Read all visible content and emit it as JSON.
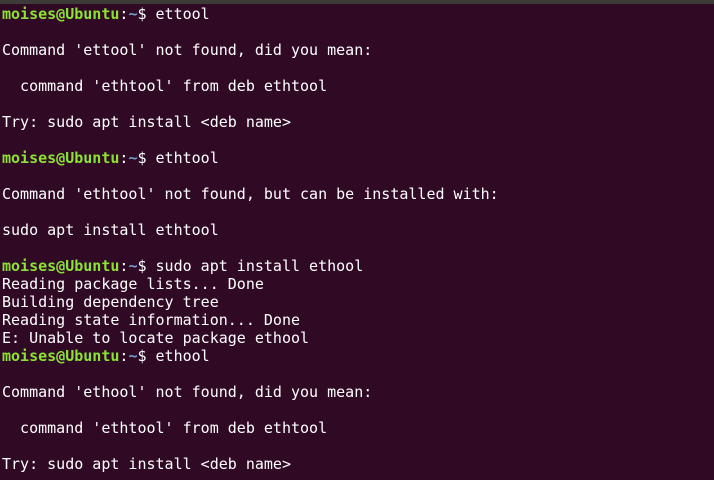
{
  "terminal": {
    "colors": {
      "background": "#300a24",
      "text": "#ffffff",
      "prompt_user": "#8ae234",
      "prompt_path": "#729fcf"
    },
    "lines": [
      {
        "type": "prompt",
        "user": "moises@Ubuntu",
        "sep": ":",
        "path": "~",
        "symbol": "$ ",
        "command": "ettool"
      },
      {
        "type": "output",
        "text": ""
      },
      {
        "type": "output",
        "text": "Command 'ettool' not found, did you mean:"
      },
      {
        "type": "output",
        "text": ""
      },
      {
        "type": "output",
        "text": "  command 'ethtool' from deb ethtool"
      },
      {
        "type": "output",
        "text": ""
      },
      {
        "type": "output",
        "text": "Try: sudo apt install <deb name>"
      },
      {
        "type": "output",
        "text": ""
      },
      {
        "type": "prompt",
        "user": "moises@Ubuntu",
        "sep": ":",
        "path": "~",
        "symbol": "$ ",
        "command": "ethtool"
      },
      {
        "type": "output",
        "text": ""
      },
      {
        "type": "output",
        "text": "Command 'ethtool' not found, but can be installed with:"
      },
      {
        "type": "output",
        "text": ""
      },
      {
        "type": "output",
        "text": "sudo apt install ethtool"
      },
      {
        "type": "output",
        "text": ""
      },
      {
        "type": "prompt",
        "user": "moises@Ubuntu",
        "sep": ":",
        "path": "~",
        "symbol": "$ ",
        "command": "sudo apt install ethool"
      },
      {
        "type": "output",
        "text": "Reading package lists... Done"
      },
      {
        "type": "output",
        "text": "Building dependency tree"
      },
      {
        "type": "output",
        "text": "Reading state information... Done"
      },
      {
        "type": "output",
        "text": "E: Unable to locate package ethool"
      },
      {
        "type": "prompt",
        "user": "moises@Ubuntu",
        "sep": ":",
        "path": "~",
        "symbol": "$ ",
        "command": "ethool"
      },
      {
        "type": "output",
        "text": ""
      },
      {
        "type": "output",
        "text": "Command 'ethool' not found, did you mean:"
      },
      {
        "type": "output",
        "text": ""
      },
      {
        "type": "output",
        "text": "  command 'ethtool' from deb ethtool"
      },
      {
        "type": "output",
        "text": ""
      },
      {
        "type": "output",
        "text": "Try: sudo apt install <deb name>"
      }
    ]
  }
}
